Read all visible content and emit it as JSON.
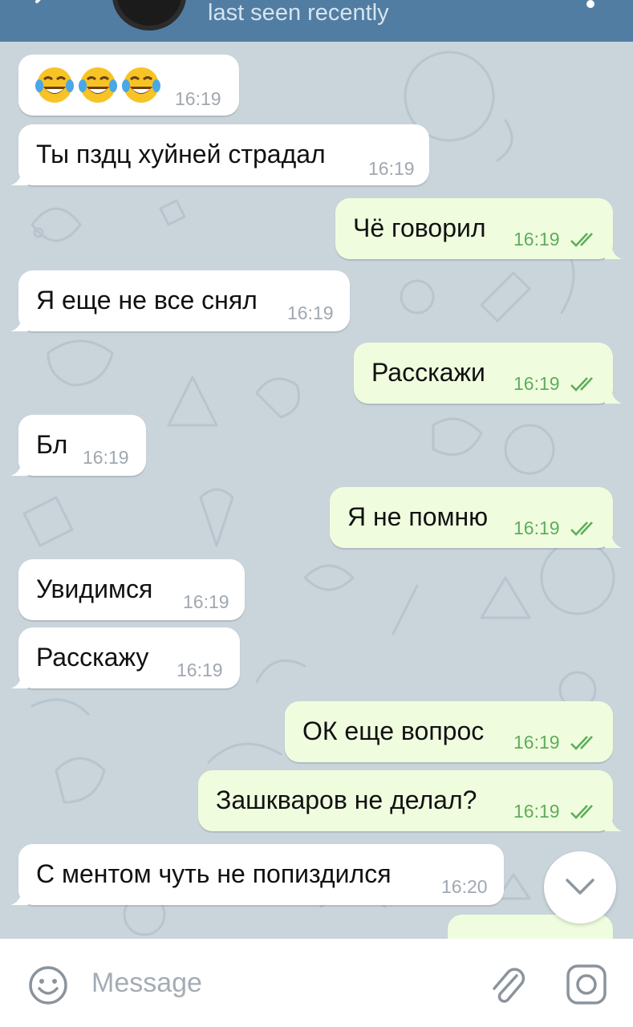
{
  "header": {
    "status": "last seen recently"
  },
  "messages": [
    {
      "dir": "in",
      "text": "",
      "emoji": [
        "joy",
        "joy",
        "joy"
      ],
      "time": "16:19"
    },
    {
      "dir": "in",
      "text": "Ты пздц хуйней страдал",
      "time": "16:19"
    },
    {
      "dir": "out",
      "text": "Чё говорил",
      "time": "16:19",
      "read": true
    },
    {
      "dir": "in",
      "text": "Я еще не все снял",
      "time": "16:19"
    },
    {
      "dir": "out",
      "text": "Расскажи",
      "time": "16:19",
      "read": true
    },
    {
      "dir": "in",
      "text": "Бл",
      "time": "16:19"
    },
    {
      "dir": "out",
      "text": "Я не помню",
      "time": "16:19",
      "read": true
    },
    {
      "dir": "in",
      "text": "Увидимся",
      "time": "16:19"
    },
    {
      "dir": "in",
      "text": "Расскажу",
      "time": "16:19"
    },
    {
      "dir": "out",
      "text": "ОК еще вопрос",
      "time": "16:19",
      "read": true
    },
    {
      "dir": "out",
      "text": "Зашкваров не делал?",
      "time": "16:19",
      "read": true
    },
    {
      "dir": "in",
      "text": "С ментом чуть не попиздился",
      "time": "16:20"
    }
  ],
  "input": {
    "placeholder": "Message"
  },
  "icons": {
    "emoji": "smile-icon",
    "attach": "paperclip-icon",
    "camera": "camera-icon",
    "scroll_down": "chevron-down-icon",
    "read_receipt": "double-check-icon"
  },
  "colors": {
    "header": "#517da2",
    "incoming_bubble": "#ffffff",
    "outgoing_bubble": "#effdde",
    "outgoing_time": "#5fad5b",
    "wallpaper": "#c9d4db"
  }
}
